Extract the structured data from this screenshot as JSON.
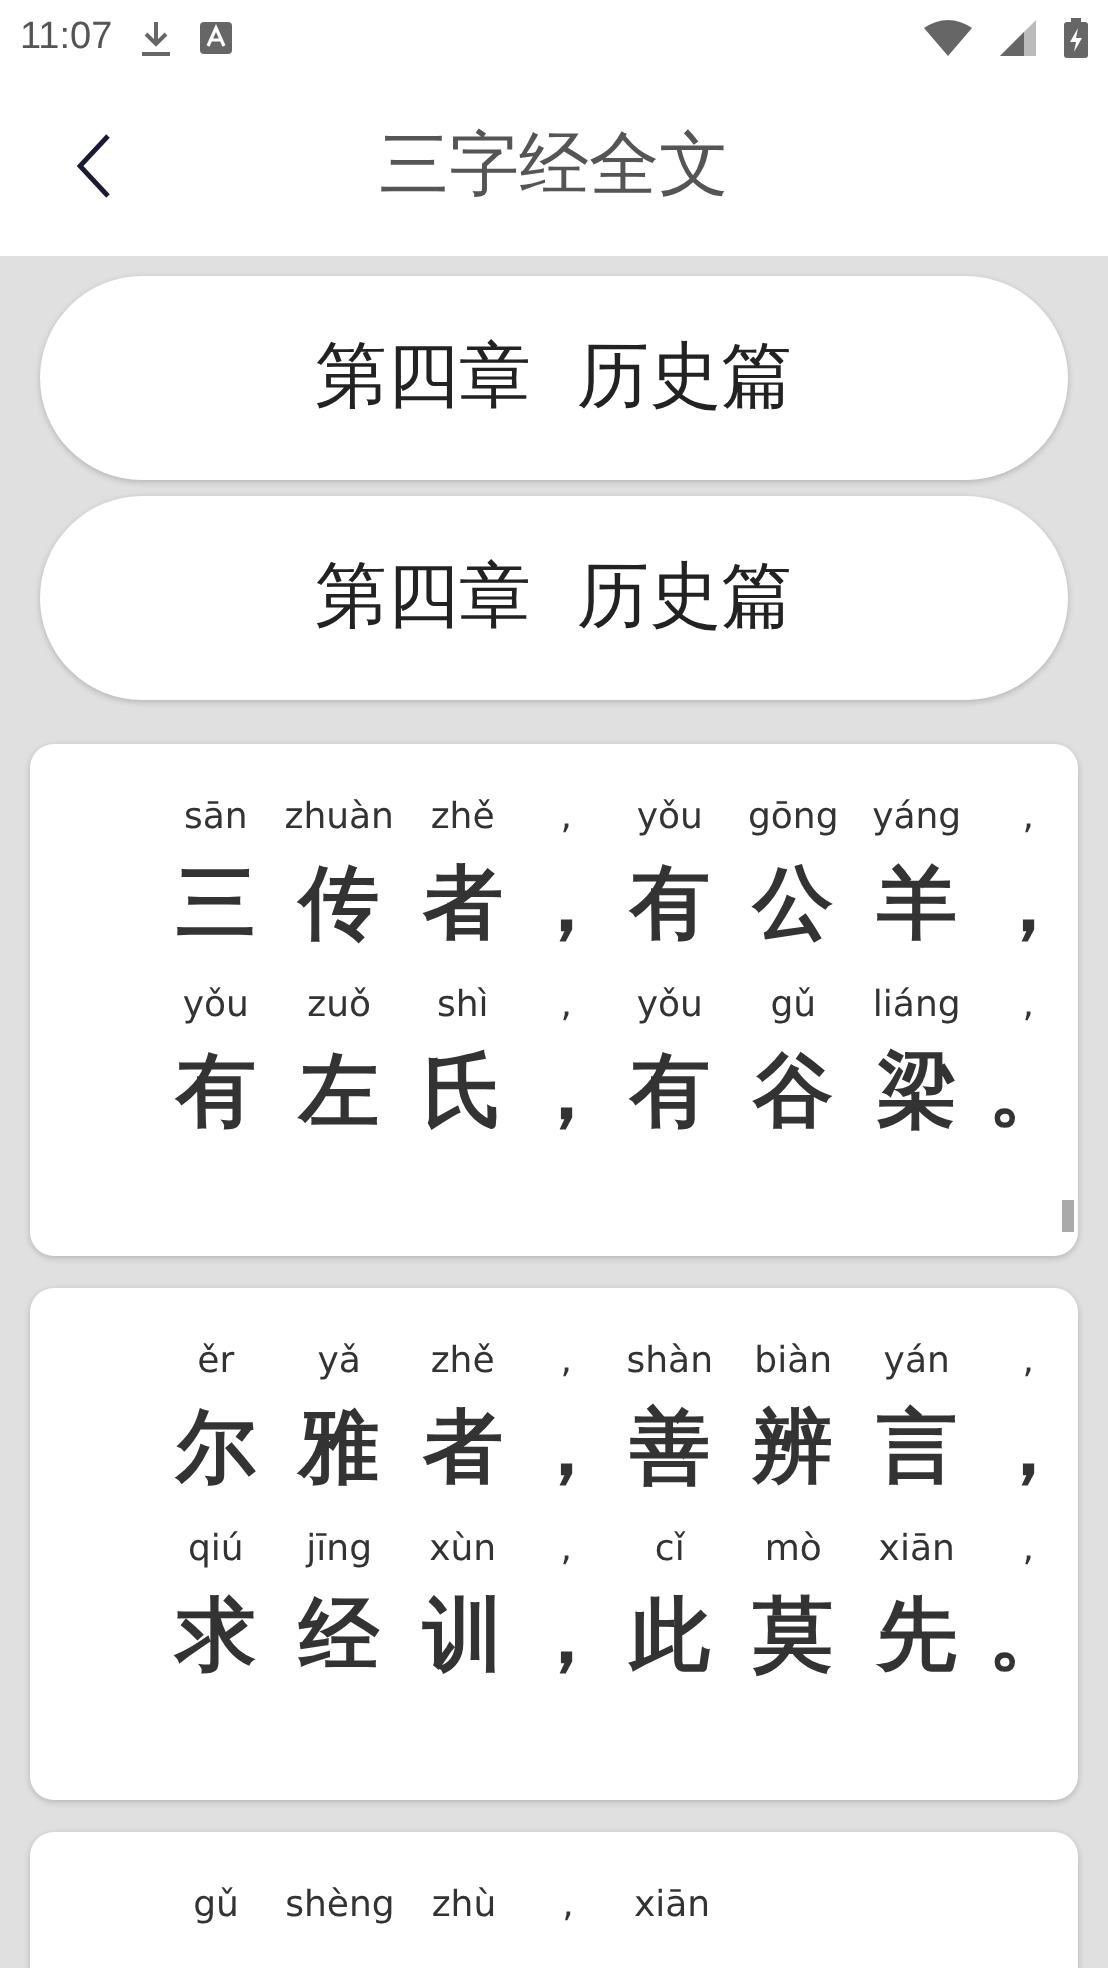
{
  "status_bar": {
    "time": "11:07"
  },
  "header": {
    "title": "三字经全文"
  },
  "chapter_buttons": [
    {
      "label": "第四章  历史篇"
    },
    {
      "label": "第四章  历史篇"
    }
  ],
  "verses": [
    {
      "lines": [
        {
          "pinyin": [
            "sān",
            "zhuàn",
            "zhě",
            ",",
            "yǒu",
            "gōng",
            "yáng",
            ","
          ],
          "chars": [
            "三",
            "传",
            "者",
            "，",
            "有",
            "公",
            "羊",
            "，"
          ]
        },
        {
          "pinyin": [
            "yǒu",
            "zuǒ",
            "shì",
            ",",
            "yǒu",
            "gǔ",
            "liáng",
            ","
          ],
          "chars": [
            "有",
            "左",
            "氏",
            "，",
            "有",
            "谷",
            "梁",
            "。"
          ]
        }
      ]
    },
    {
      "lines": [
        {
          "pinyin": [
            "ěr",
            "yǎ",
            "zhě",
            ",",
            "shàn",
            "biàn",
            "yán",
            ","
          ],
          "chars": [
            "尔",
            "雅",
            "者",
            "，",
            "善",
            "辨",
            "言",
            "，"
          ]
        },
        {
          "pinyin": [
            "qiú",
            "jīng",
            "xùn",
            ",",
            "cǐ",
            "mò",
            "xiān",
            ","
          ],
          "chars": [
            "求",
            "经",
            "训",
            "，",
            "此",
            "莫",
            "先",
            "。"
          ]
        }
      ]
    },
    {
      "lines": [
        {
          "pinyin": [
            "gǔ",
            "shèng",
            "zhù",
            ",",
            "xiān"
          ]
        }
      ]
    }
  ]
}
